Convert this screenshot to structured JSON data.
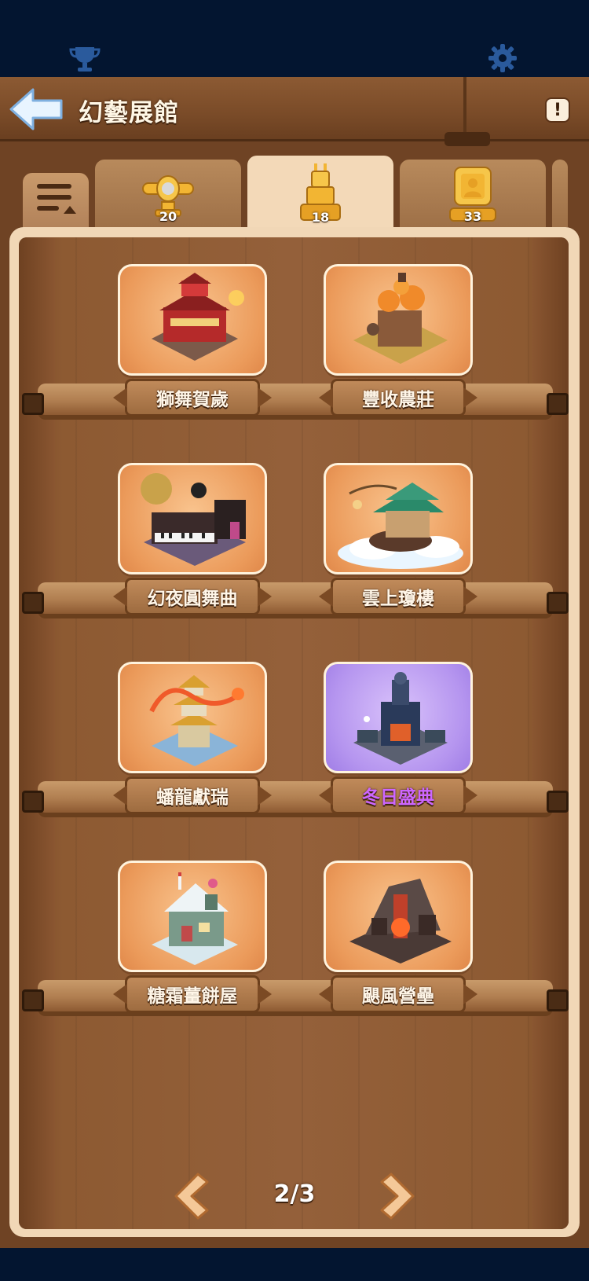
{
  "header": {
    "title": "幻藝展館"
  },
  "tabs": [
    {
      "id": "airplane",
      "count": "20",
      "active": false
    },
    {
      "id": "tower",
      "count": "18",
      "active": true
    },
    {
      "id": "frame",
      "count": "33",
      "active": false
    }
  ],
  "exhibits": [
    {
      "name": "獅舞賀歲",
      "art": "lion-dance-palace-art"
    },
    {
      "name": "豐收農莊",
      "art": "harvest-farm-art"
    },
    {
      "name": "幻夜圓舞曲",
      "art": "night-waltz-piano-art"
    },
    {
      "name": "雲上瓊樓",
      "art": "cloud-pavilion-art"
    },
    {
      "name": "蟠龍獻瑞",
      "art": "dragon-pagoda-art"
    },
    {
      "name": "冬日盛典",
      "art": "winter-gala-tower-art",
      "highlight": true
    },
    {
      "name": "糖霜薑餅屋",
      "art": "gingerbread-house-art"
    },
    {
      "name": "颶風營壘",
      "art": "storm-fortress-art"
    }
  ],
  "pager": {
    "text": "2/3"
  },
  "colors": {
    "card_orange": "#eb9a5a",
    "card_purple": "#b595ef",
    "label_purple": "#cc66ff",
    "wood": "#8d5a32"
  }
}
